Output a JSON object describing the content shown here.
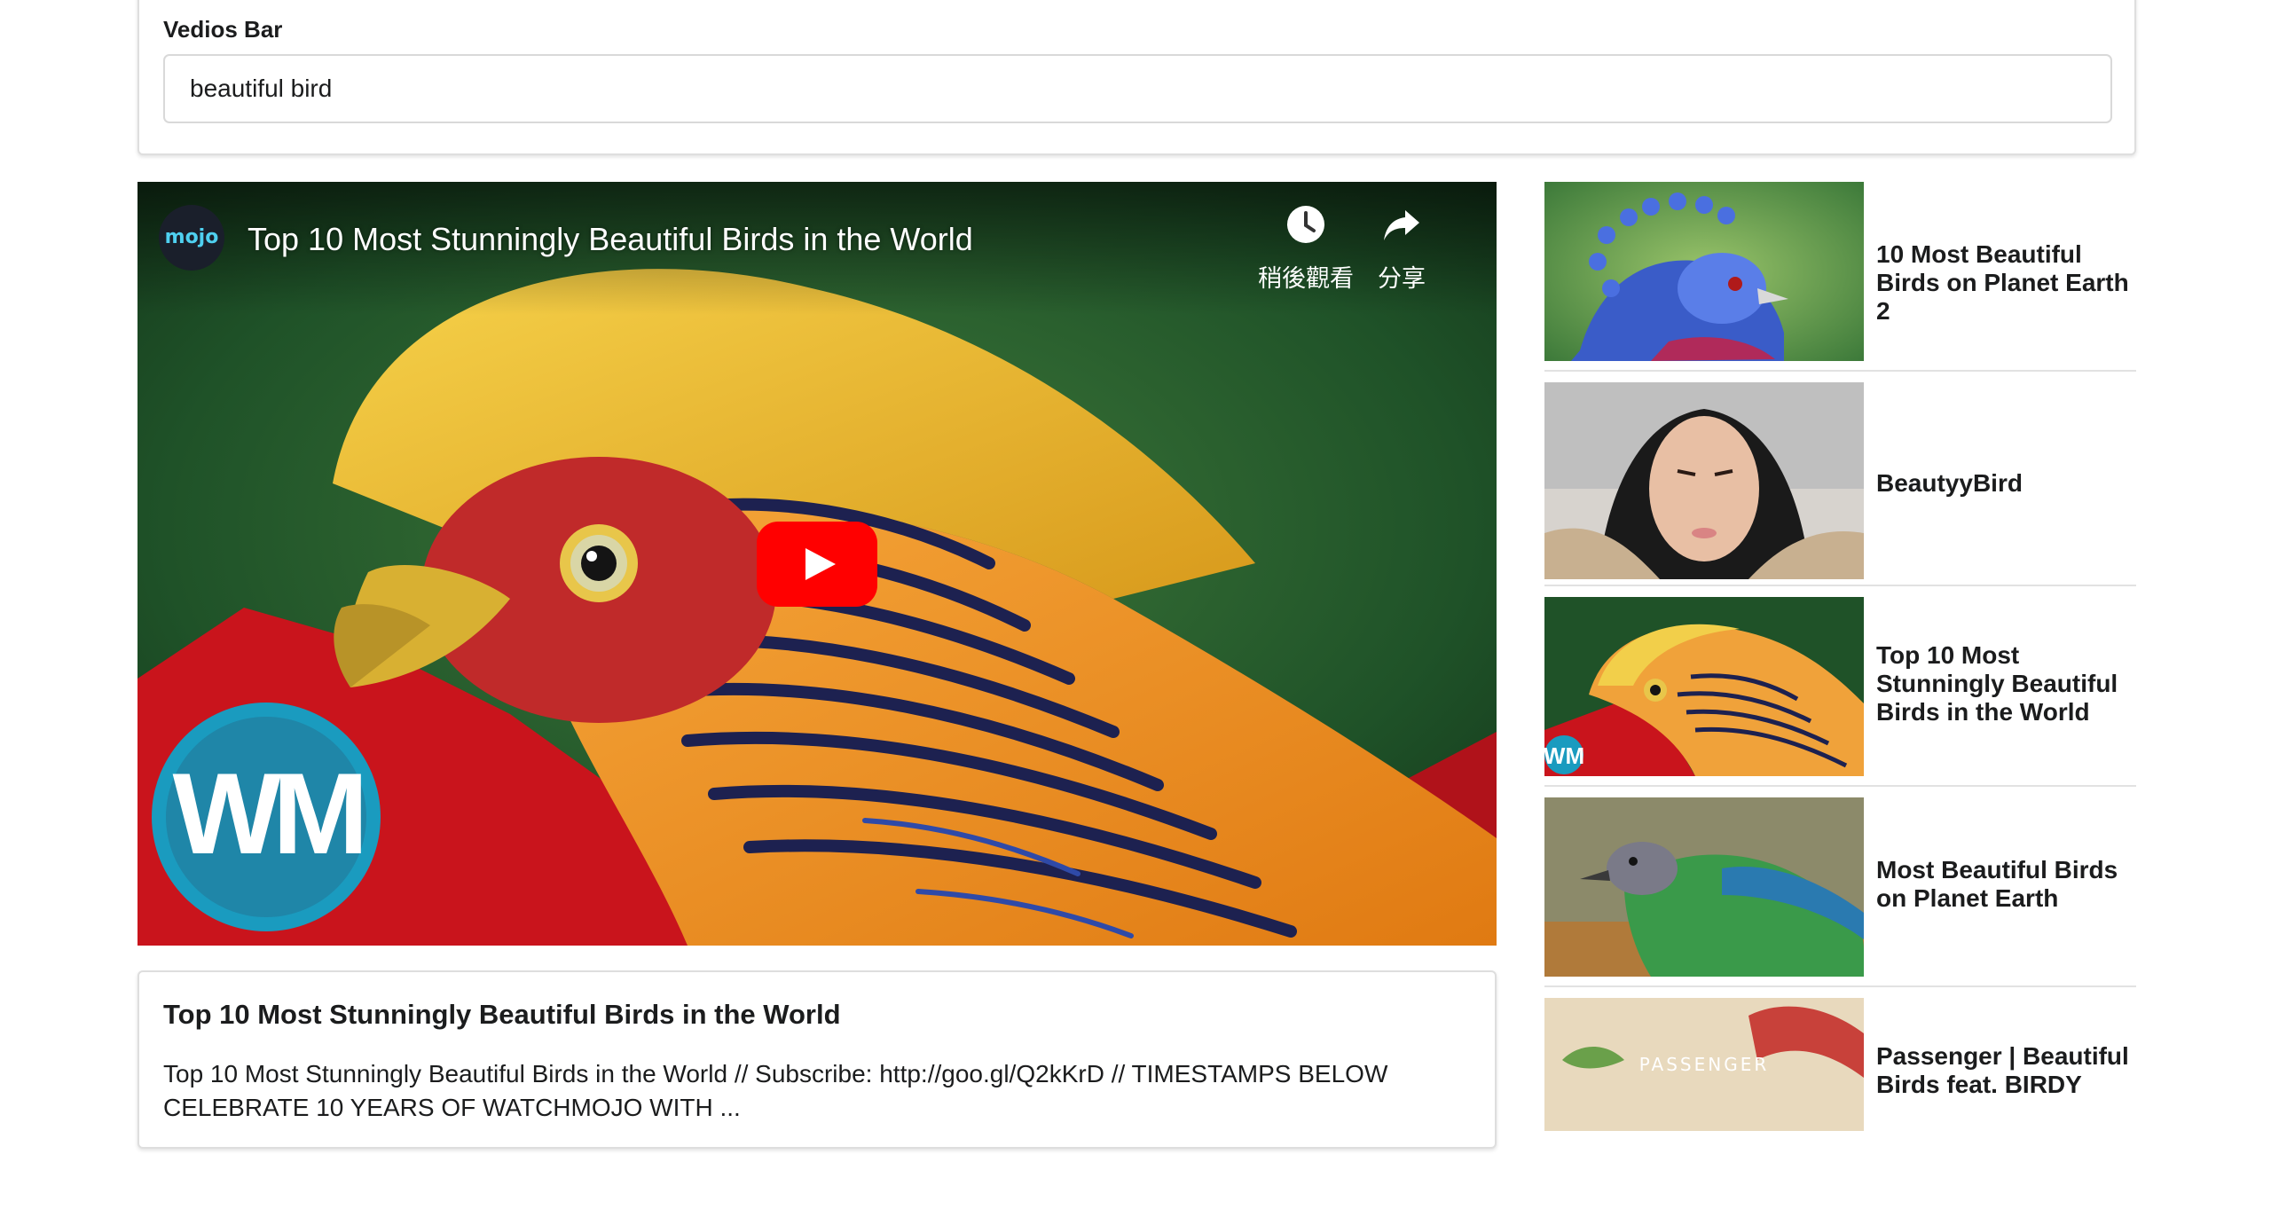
{
  "search": {
    "label": "Vedios Bar",
    "value": "beautiful bird"
  },
  "player": {
    "channel_avatar": "mojo",
    "title": "Top 10 Most Stunningly Beautiful Birds in the World",
    "watch_later_label": "稍後觀看",
    "share_label": "分享",
    "logo_text": "WM",
    "icons": {
      "watch_later": "clock-icon",
      "share": "share-arrow-icon",
      "play": "play-icon"
    },
    "colors": {
      "play_button": "#ff0000",
      "logo_circle": "#1a9bbf",
      "logo_text": "#ffffff"
    }
  },
  "description": {
    "title": "Top 10 Most Stunningly Beautiful Birds in the World",
    "text": "Top 10 Most Stunningly Beautiful Birds in the World // Subscribe: http://goo.gl/Q2kKrD // TIMESTAMPS BELOW CELEBRATE 10 YEARS OF WATCHMOJO WITH ..."
  },
  "video_list": [
    {
      "title": "10 Most Beautiful Birds on Planet Earth 2"
    },
    {
      "title": "BeautyyBird"
    },
    {
      "title": "Top 10 Most Stunningly Beautiful Birds in the World",
      "thumb_logo": "WM"
    },
    {
      "title": "Most Beautiful Birds on Planet Earth"
    },
    {
      "title": "Passenger | Beautiful Birds feat. BIRDY",
      "thumb_text": "PASSENGER"
    }
  ]
}
